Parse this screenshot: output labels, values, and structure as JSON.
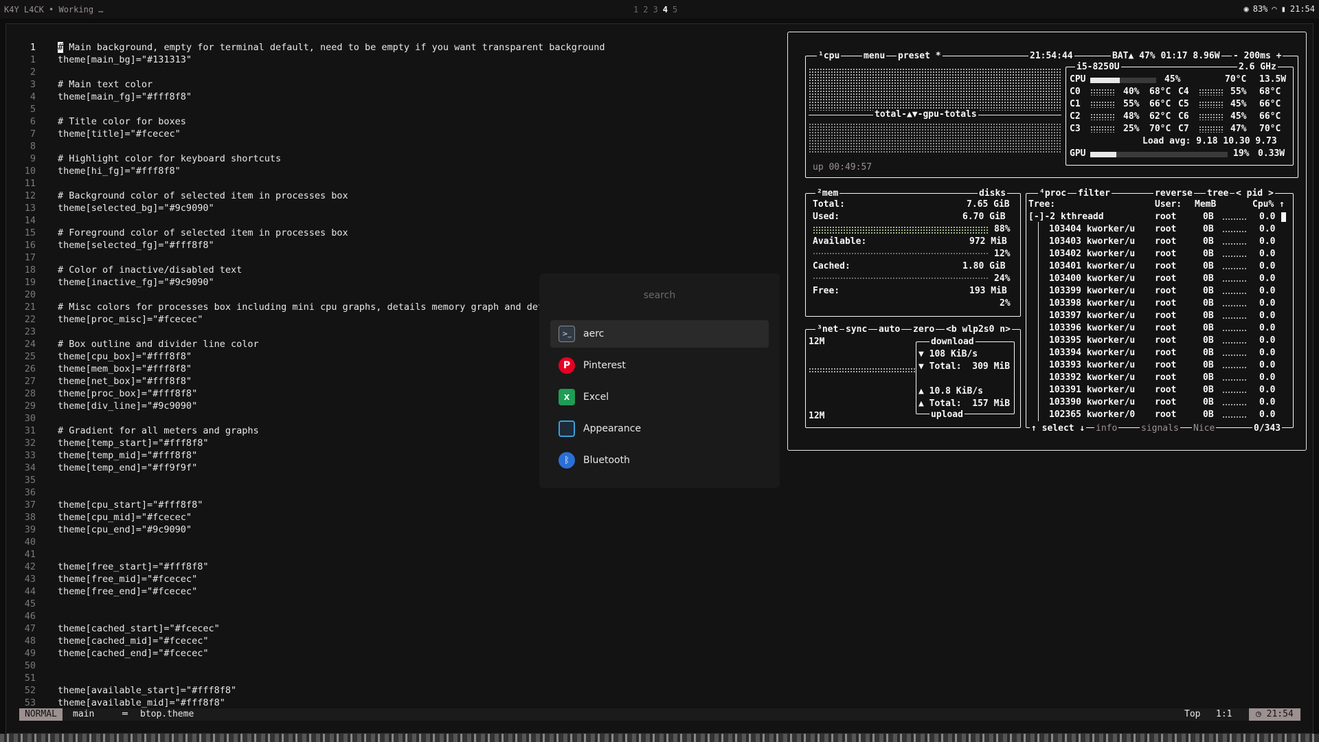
{
  "topbar": {
    "title": "K4Y L4CK • Working …",
    "workspaces": [
      "1",
      "2",
      "3",
      "4",
      "5"
    ],
    "active_ws": "4",
    "battery": "83%",
    "time": "21:54"
  },
  "editor": {
    "lines": [
      {
        "n": "1",
        "t": " Main background, empty for terminal default, need to be empty if you want transparent background",
        "cursor": "#"
      },
      {
        "n": "1",
        "t": "theme[main_bg]=\"#131313\""
      },
      {
        "n": "2",
        "t": ""
      },
      {
        "n": "3",
        "t": "# Main text color"
      },
      {
        "n": "4",
        "t": "theme[main_fg]=\"#fff8f8\""
      },
      {
        "n": "5",
        "t": ""
      },
      {
        "n": "6",
        "t": "# Title color for boxes"
      },
      {
        "n": "7",
        "t": "theme[title]=\"#fcecec\""
      },
      {
        "n": "8",
        "t": ""
      },
      {
        "n": "9",
        "t": "# Highlight color for keyboard shortcuts"
      },
      {
        "n": "10",
        "t": "theme[hi_fg]=\"#fff8f8\""
      },
      {
        "n": "11",
        "t": ""
      },
      {
        "n": "12",
        "t": "# Background color of selected item in processes box"
      },
      {
        "n": "13",
        "t": "theme[selected_bg]=\"#9c9090\""
      },
      {
        "n": "14",
        "t": ""
      },
      {
        "n": "15",
        "t": "# Foreground color of selected item in processes box"
      },
      {
        "n": "16",
        "t": "theme[selected_fg]=\"#fff8f8\""
      },
      {
        "n": "17",
        "t": ""
      },
      {
        "n": "18",
        "t": "# Color of inactive/disabled text"
      },
      {
        "n": "19",
        "t": "theme[inactive_fg]=\"#9c9090\""
      },
      {
        "n": "20",
        "t": ""
      },
      {
        "n": "21",
        "t": "# Misc colors for processes box including mini cpu graphs, details memory graph and deta"
      },
      {
        "n": "22",
        "t": "theme[proc_misc]=\"#fcecec\""
      },
      {
        "n": "23",
        "t": ""
      },
      {
        "n": "24",
        "t": "# Box outline and divider line color"
      },
      {
        "n": "25",
        "t": "theme[cpu_box]=\"#fff8f8\""
      },
      {
        "n": "26",
        "t": "theme[mem_box]=\"#fff8f8\""
      },
      {
        "n": "27",
        "t": "theme[net_box]=\"#fff8f8\""
      },
      {
        "n": "28",
        "t": "theme[proc_box]=\"#fff8f8\""
      },
      {
        "n": "29",
        "t": "theme[div_line]=\"#9c9090\""
      },
      {
        "n": "30",
        "t": ""
      },
      {
        "n": "31",
        "t": "# Gradient for all meters and graphs"
      },
      {
        "n": "32",
        "t": "theme[temp_start]=\"#fff8f8\""
      },
      {
        "n": "33",
        "t": "theme[temp_mid]=\"#fff8f8\""
      },
      {
        "n": "34",
        "t": "theme[temp_end]=\"#ff9f9f\""
      },
      {
        "n": "35",
        "t": ""
      },
      {
        "n": "36",
        "t": ""
      },
      {
        "n": "37",
        "t": "theme[cpu_start]=\"#fff8f8\""
      },
      {
        "n": "38",
        "t": "theme[cpu_mid]=\"#fcecec\""
      },
      {
        "n": "39",
        "t": "theme[cpu_end]=\"#9c9090\""
      },
      {
        "n": "40",
        "t": ""
      },
      {
        "n": "41",
        "t": ""
      },
      {
        "n": "42",
        "t": "theme[free_start]=\"#fff8f8\""
      },
      {
        "n": "43",
        "t": "theme[free_mid]=\"#fcecec\""
      },
      {
        "n": "44",
        "t": "theme[free_end]=\"#fcecec\""
      },
      {
        "n": "45",
        "t": ""
      },
      {
        "n": "46",
        "t": ""
      },
      {
        "n": "47",
        "t": "theme[cached_start]=\"#fcecec\""
      },
      {
        "n": "48",
        "t": "theme[cached_mid]=\"#fcecec\""
      },
      {
        "n": "49",
        "t": "theme[cached_end]=\"#fcecec\""
      },
      {
        "n": "50",
        "t": ""
      },
      {
        "n": "51",
        "t": ""
      },
      {
        "n": "52",
        "t": "theme[available_start]=\"#fff8f8\""
      },
      {
        "n": "53",
        "t": "theme[available_mid]=\"#fff8f8\""
      }
    ]
  },
  "statusline": {
    "mode": "NORMAL",
    "branch": " main",
    "sep": "═",
    "file": "btop.theme",
    "scroll": "Top",
    "pos": "1:1",
    "time": "◷ 21:54"
  },
  "launcher": {
    "placeholder": "search",
    "items": [
      {
        "label": "aerc",
        "icon": "terminal-icon"
      },
      {
        "label": "Pinterest",
        "icon": "pinterest-icon"
      },
      {
        "label": "Excel",
        "icon": "excel-icon"
      },
      {
        "label": "Appearance",
        "icon": "appearance-icon"
      },
      {
        "label": "Bluetooth",
        "icon": "bluetooth-icon"
      }
    ]
  },
  "btop": {
    "cpu_header": {
      "cpu": "¹cpu",
      "menu": "menu",
      "preset": "preset *",
      "clock": "21:54:44",
      "battery": "BAT▲ 47% 01:17 8.96W",
      "refresh": "- 200ms +"
    },
    "cpu_model": "i5-8250U",
    "cpu_freq": "2.6 GHz",
    "cpu_total": {
      "label": "CPU",
      "pct": "45%",
      "temp": "70°C",
      "watt": "13.5W"
    },
    "cores": [
      {
        "l": "C0",
        "p": "40%",
        "t": "68°C",
        "l2": "C4",
        "p2": "55%",
        "t2": "68°C"
      },
      {
        "l": "C1",
        "p": "55%",
        "t": "66°C",
        "l2": "C5",
        "p2": "45%",
        "t2": "66°C"
      },
      {
        "l": "C2",
        "p": "48%",
        "t": "62°C",
        "l2": "C6",
        "p2": "45%",
        "t2": "66°C"
      },
      {
        "l": "C3",
        "p": "25%",
        "t": "70°C",
        "l2": "C7",
        "p2": "47%",
        "t2": "70°C"
      }
    ],
    "load_avg": "Load avg: 9.18 10.30 9.73",
    "gpu": {
      "label": "GPU",
      "pct": "19%",
      "watt": "0.33W"
    },
    "graph_label": "total-▲▼-gpu-totals",
    "uptime": "up 00:49:57",
    "mem": {
      "title": "²mem",
      "disks": "disks",
      "total_label": "Total:",
      "total": "7.65 GiB",
      "used_label": "Used:",
      "used": "6.70 GiB",
      "used_pct": "88%",
      "avail_label": "Available:",
      "avail": "972 MiB",
      "avail_pct": "12%",
      "cached_label": "Cached:",
      "cached": "1.80 GiB",
      "cached_pct": "24%",
      "free_label": "Free:",
      "free": "193 MiB",
      "free_pct": "2%"
    },
    "net": {
      "title": "³net",
      "sync": "sync",
      "auto": "auto",
      "zero": "zero",
      "iface": "<b wlp2s0 n>",
      "scale_top": "12M",
      "scale_bot": "12M",
      "dl_title": "download",
      "dl_rate": "▼ 108 KiB/s",
      "dl_total": "▼ Total:  309 MiB",
      "ul_rate": "▲ 10.8 KiB/s",
      "ul_total": "▲ Total:  157 MiB",
      "ul_title": "upload"
    },
    "proc": {
      "title": "⁴proc",
      "filter": "filter",
      "reverse": "reverse",
      "tree": "tree",
      "sort": "< pid >",
      "tree_label": "Tree:",
      "user_h": "User:",
      "mem_h": "MemB",
      "cpu_h": "Cpu% ↑",
      "rows": [
        {
          "name": "[-]-2 kthreadd",
          "user": "root",
          "mem": "0B",
          "cpu": "0.0"
        },
        {
          "name": "103404 kworker/u",
          "user": "root",
          "mem": "0B",
          "cpu": "0.0"
        },
        {
          "name": "103403 kworker/u",
          "user": "root",
          "mem": "0B",
          "cpu": "0.0"
        },
        {
          "name": "103402 kworker/u",
          "user": "root",
          "mem": "0B",
          "cpu": "0.0"
        },
        {
          "name": "103401 kworker/u",
          "user": "root",
          "mem": "0B",
          "cpu": "0.0"
        },
        {
          "name": "103400 kworker/u",
          "user": "root",
          "mem": "0B",
          "cpu": "0.0"
        },
        {
          "name": "103399 kworker/u",
          "user": "root",
          "mem": "0B",
          "cpu": "0.0"
        },
        {
          "name": "103398 kworker/u",
          "user": "root",
          "mem": "0B",
          "cpu": "0.0"
        },
        {
          "name": "103397 kworker/u",
          "user": "root",
          "mem": "0B",
          "cpu": "0.0"
        },
        {
          "name": "103396 kworker/u",
          "user": "root",
          "mem": "0B",
          "cpu": "0.0"
        },
        {
          "name": "103395 kworker/u",
          "user": "root",
          "mem": "0B",
          "cpu": "0.0"
        },
        {
          "name": "103394 kworker/u",
          "user": "root",
          "mem": "0B",
          "cpu": "0.0"
        },
        {
          "name": "103393 kworker/u",
          "user": "root",
          "mem": "0B",
          "cpu": "0.0"
        },
        {
          "name": "103392 kworker/u",
          "user": "root",
          "mem": "0B",
          "cpu": "0.0"
        },
        {
          "name": "103391 kworker/u",
          "user": "root",
          "mem": "0B",
          "cpu": "0.0"
        },
        {
          "name": "103390 kworker/u",
          "user": "root",
          "mem": "0B",
          "cpu": "0.0"
        },
        {
          "name": "102365 kworker/0",
          "user": "root",
          "mem": "0B",
          "cpu": "0.0"
        }
      ],
      "select": "↑ select ↓",
      "info": "info",
      "signals": "signals",
      "nice": "Nice",
      "count": "0/343"
    }
  }
}
